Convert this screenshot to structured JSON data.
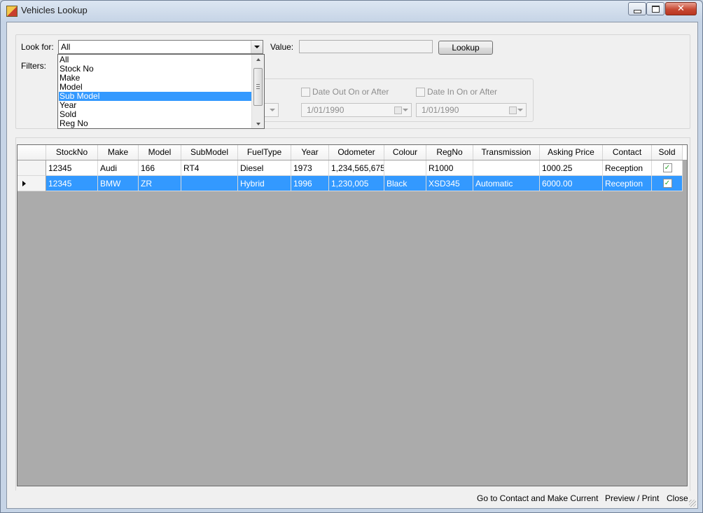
{
  "window": {
    "title": "Vehicles Lookup"
  },
  "search": {
    "look_for_label": "Look for:",
    "look_for_value": "All",
    "value_label": "Value:",
    "value_text": "",
    "lookup_button": "Lookup",
    "filters_label": "Filters:"
  },
  "dropdown": {
    "items": [
      "All",
      "Stock No",
      "Make",
      "Model",
      "Sub Model",
      "Year",
      "Sold",
      "Reg No"
    ],
    "selected": "Sub Model"
  },
  "filters": {
    "date_out_label": "Date Out On or After",
    "date_out_value": "1/01/1990",
    "date_in_label": "Date In On or After",
    "date_in_value": "1/01/1990"
  },
  "grid": {
    "columns": [
      "StockNo",
      "Make",
      "Model",
      "SubModel",
      "FuelType",
      "Year",
      "Odometer",
      "Colour",
      "RegNo",
      "Transmission",
      "Asking Price",
      "Contact",
      "Sold"
    ],
    "rows": [
      {
        "StockNo": "12345",
        "Make": "Audi",
        "Model": "166",
        "SubModel": "RT4",
        "FuelType": "Diesel",
        "Year": "1973",
        "Odometer": "1,234,565,675",
        "Colour": "",
        "RegNo": "R1000",
        "Transmission": "",
        "AskingPrice": "1000.25",
        "Contact": "Reception",
        "Sold": true,
        "selected": false
      },
      {
        "StockNo": "12345",
        "Make": "BMW",
        "Model": "ZR",
        "SubModel": "",
        "FuelType": "Hybrid",
        "Year": "1996",
        "Odometer": "1,230,005",
        "Colour": "Black",
        "RegNo": "XSD345",
        "Transmission": "Automatic",
        "AskingPrice": "6000.00",
        "Contact": "Reception",
        "Sold": true,
        "selected": true
      }
    ]
  },
  "footer": {
    "goto_contact": "Go to Contact and Make Current",
    "preview_print": "Preview / Print",
    "close": "Close"
  },
  "colors": {
    "selection": "#3399ff",
    "grid_background": "#ababab"
  }
}
